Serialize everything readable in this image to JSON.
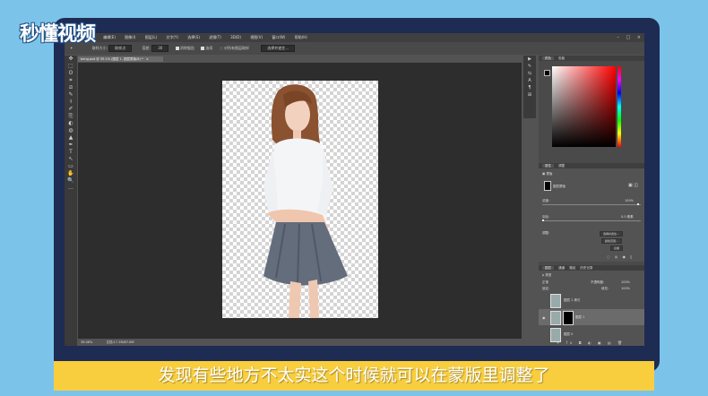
{
  "logo": {
    "text": "秒懂视频"
  },
  "menubar": {
    "ps_mark": "Ps",
    "items": [
      "文件(F)",
      "编辑(E)",
      "图像(I)",
      "图层(L)",
      "文字(Y)",
      "选择(S)",
      "滤镜(T)",
      "3D(D)",
      "视图(V)",
      "窗口(W)",
      "帮助(H)"
    ],
    "window_controls": [
      "–",
      "□",
      "×"
    ]
  },
  "options": {
    "sample_label": "取样大小:",
    "sample_value": "取样点",
    "tolerance_label": "容差:",
    "tolerance_value": "30",
    "antialias_label": "消除锯齿",
    "contiguous_label": "连续",
    "all_layers_label": "对所有图层取样",
    "refine_button": "选择并遮住..."
  },
  "document": {
    "tab_title": "beng.psd @ 39.1% (图层 1, 图层蒙版/8) *",
    "close": "×",
    "zoom": "36.06%",
    "doc_info": "文档:17.2M/67.8M"
  },
  "panels": {
    "color_tabs": [
      "颜色",
      "色板"
    ],
    "props_tabs": [
      "属性",
      "调整"
    ],
    "props_header": "蒙版",
    "props_selection": "图层蒙版",
    "density_label": "浓度:",
    "density_value": "100%",
    "feather_label": "羽化:",
    "feather_value": "0.0 像素",
    "adjust_label": "调整:",
    "select_mask_button": "选择并遮住...",
    "color_range_button": "颜色范围...",
    "invert_button": "反相",
    "layers_tabs": [
      "图层",
      "通道",
      "路径",
      "历史记录"
    ],
    "kind_label": "类型",
    "blend_mode": "正常",
    "opacity_label": "不透明度:",
    "opacity_value": "100%",
    "lock_label": "锁定:",
    "fill_label": "填充:",
    "fill_value": "100%",
    "layers": [
      {
        "name": "图层 1 拷贝",
        "visible": false,
        "has_mask": false,
        "selected": false
      },
      {
        "name": "图层 1",
        "visible": true,
        "has_mask": true,
        "selected": true
      },
      {
        "name": "图层 0",
        "visible": false,
        "has_mask": false,
        "selected": false
      }
    ]
  },
  "tools": [
    "✥",
    "⬚",
    "ʘ",
    "⌗",
    "⧄",
    "✎",
    "⚕",
    "✐",
    "⎘",
    "◐",
    "◍",
    "▲",
    "✒",
    "T",
    "↖",
    "▭",
    "✋",
    "🔍",
    "…"
  ],
  "dock_tools": [
    "▶",
    "✎",
    "⇆",
    "A",
    "¶",
    "⊞"
  ],
  "colors": {
    "accent": "#f8ce3e",
    "frame": "#1e2b53",
    "background": "#7cc3ea"
  },
  "subtitle": "发现有些地方不太实这个时候就可以在蒙版里调整了"
}
